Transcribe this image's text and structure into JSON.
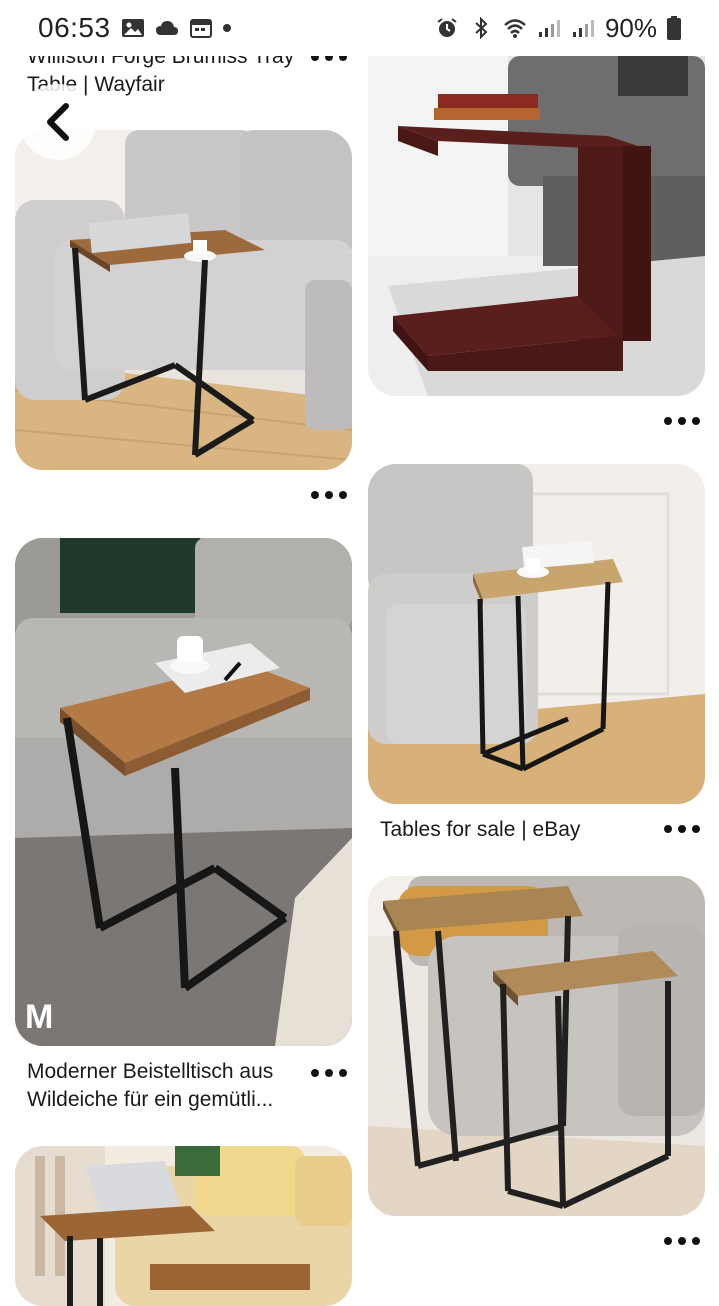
{
  "status_bar": {
    "time": "06:53",
    "battery": "90%",
    "left_icons": [
      "gallery-icon",
      "cloud-icon",
      "calendar-icon",
      "dot-icon"
    ],
    "right_icons": [
      "alarm-icon",
      "bluetooth-icon",
      "wifi-icon",
      "signal-icon",
      "signal-icon",
      "battery-icon"
    ]
  },
  "feed": {
    "left": [
      {
        "title": "Williston Forge Brumiss Tray Table | Wayfair"
      },
      {
        "title": ""
      },
      {
        "title": "Moderner Beistelltisch aus Wildeiche für ein gemütli..."
      },
      {
        "title": ""
      }
    ],
    "right": [
      {
        "title": ""
      },
      {
        "title": "Tables for sale | eBay"
      },
      {
        "title": ""
      }
    ]
  },
  "watermark": "M"
}
